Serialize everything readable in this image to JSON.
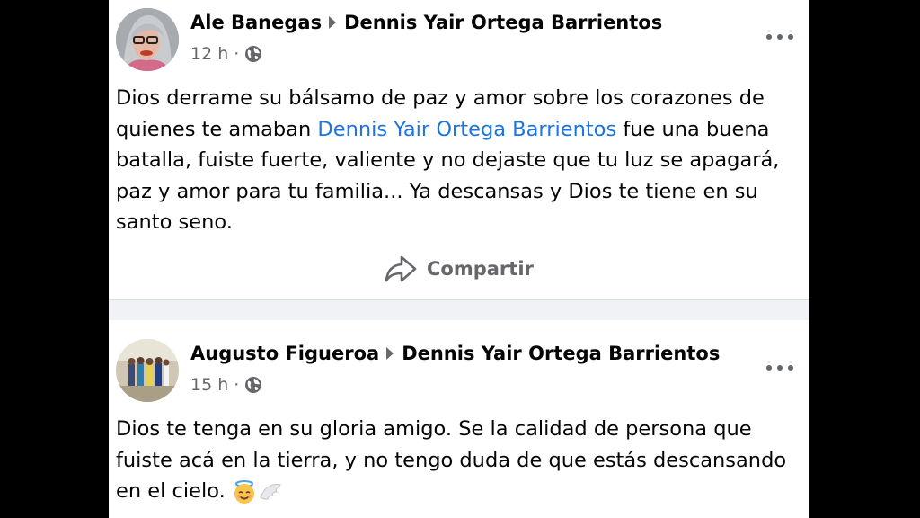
{
  "posts": [
    {
      "author": "Ale Banegas",
      "target": "Dennis Yair Ortega Barrientos",
      "time": "12 h",
      "separator": "·",
      "text_before": "Dios derrame su bálsamo de paz y amor sobre los corazones de quienes te amaban ",
      "mention": "Dennis Yair Ortega Barrientos",
      "text_after": " fue una buena batalla, fuiste fuerte, valiente y no dejaste que tu luz se apagará, paz y amor para tu familia... Ya descansas y Dios te tiene en su santo seno.",
      "share_label": "Compartir",
      "icons": [
        "avatar-photo",
        "globe-icon",
        "more-icon",
        "share-icon"
      ]
    },
    {
      "author": "Augusto Figueroa",
      "target": "Dennis Yair Ortega Barrientos",
      "time": "15 h",
      "separator": "·",
      "text": "Dios te tenga en su gloria amigo. Se la calidad de persona que fuiste acá en la tierra, y no tengo duda de que estás descansando en el cielo.",
      "icons": [
        "avatar-photo",
        "globe-icon",
        "more-icon",
        "halo-smile-emoji",
        "wing-emoji"
      ]
    }
  ],
  "colors": {
    "mention": "#1b74e4",
    "secondary_text": "#65676b",
    "background": "#f0f2f5"
  }
}
